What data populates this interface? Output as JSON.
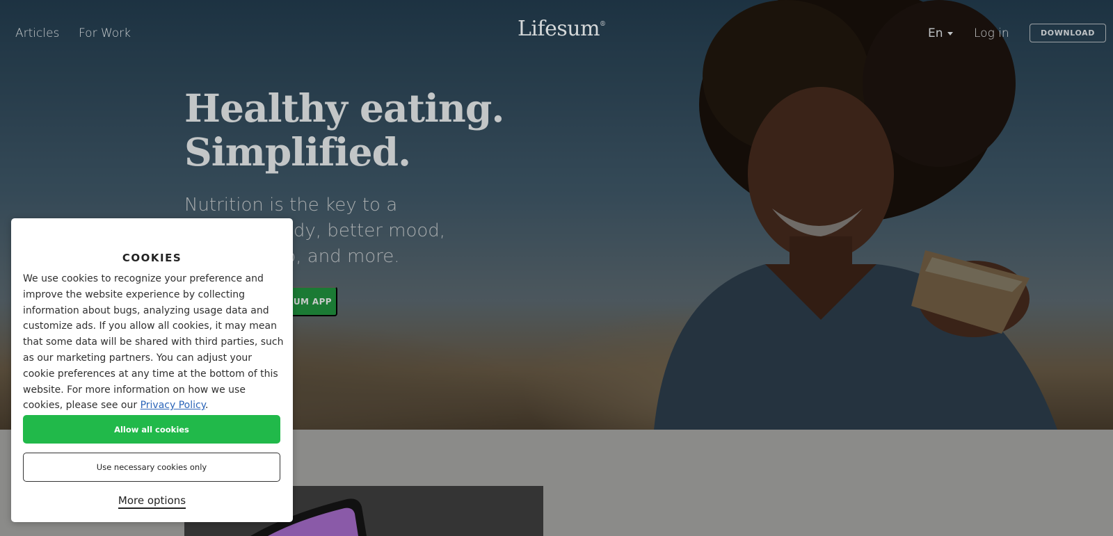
{
  "nav": {
    "links": [
      "Articles",
      "For Work"
    ],
    "logo": "Lifesum",
    "logo_mark": "®",
    "language": "En",
    "login": "Log in",
    "download": "DOWNLOAD"
  },
  "hero": {
    "headline_line1": "Healthy eating.",
    "headline_line2": "Simplified.",
    "subtext": "Nutrition is the key to a healthier body, better mood, restful sleep, and more.",
    "cta": "GET THE FREE PREMIUM APP"
  },
  "cookie": {
    "title": "COOKIES",
    "body": "We use cookies to recognize your preference and improve the website experience by collecting information about bugs, analyzing usage data and customize ads. If you allow all cookies, it may mean that some data will be shared with third parties, such as our marketing partners. You can adjust your cookie preferences at any time at the bottom of this website. For more information on how we use cookies, please see our ",
    "link_text": "Privacy Policy",
    "body_end": ".",
    "allow_all": "Allow all cookies",
    "necessary_only": "Use necessary cookies only",
    "more_options": "More options"
  },
  "colors": {
    "accent_green": "#21b94a",
    "link_blue": "#2a64b8"
  }
}
